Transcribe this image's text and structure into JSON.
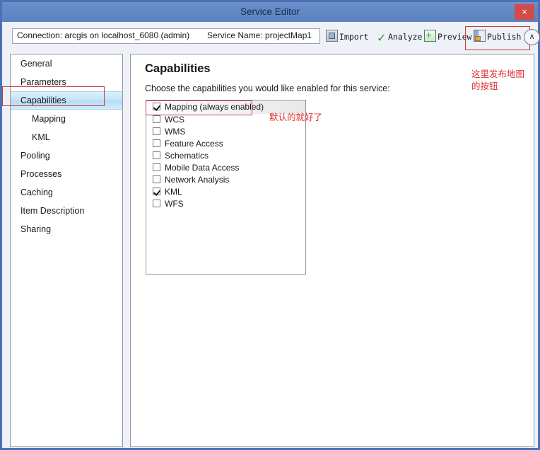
{
  "window": {
    "title": "Service Editor",
    "close_label": "×"
  },
  "toolbar": {
    "connection_text": "Connection: arcgis on localhost_6080 (admin)",
    "service_name_text": "Service Name: projectMap1",
    "buttons": [
      {
        "label": "Import",
        "icon": "import-icon"
      },
      {
        "label": "Analyze",
        "icon": "check-icon"
      },
      {
        "label": "Preview",
        "icon": "preview-icon"
      },
      {
        "label": "Publish",
        "icon": "publish-icon"
      }
    ],
    "collapse_label": "∧"
  },
  "sidebar": {
    "items": [
      {
        "label": "General",
        "indent": false,
        "selected": false
      },
      {
        "label": "Parameters",
        "indent": false,
        "selected": false
      },
      {
        "label": "Capabilities",
        "indent": false,
        "selected": true
      },
      {
        "label": "Mapping",
        "indent": true,
        "selected": false
      },
      {
        "label": "KML",
        "indent": true,
        "selected": false
      },
      {
        "label": "Pooling",
        "indent": false,
        "selected": false
      },
      {
        "label": "Processes",
        "indent": false,
        "selected": false
      },
      {
        "label": "Caching",
        "indent": false,
        "selected": false
      },
      {
        "label": "Item Description",
        "indent": false,
        "selected": false
      },
      {
        "label": "Sharing",
        "indent": false,
        "selected": false
      }
    ]
  },
  "main": {
    "title": "Capabilities",
    "subtitle": "Choose the capabilities you would like enabled for this service:",
    "capabilities": [
      {
        "label": "Mapping (always enabled)",
        "checked": true
      },
      {
        "label": "WCS",
        "checked": false
      },
      {
        "label": "WMS",
        "checked": false
      },
      {
        "label": "Feature Access",
        "checked": false
      },
      {
        "label": "Schematics",
        "checked": false
      },
      {
        "label": "Mobile Data Access",
        "checked": false
      },
      {
        "label": "Network Analysis",
        "checked": false
      },
      {
        "label": "KML",
        "checked": true
      },
      {
        "label": "WFS",
        "checked": false
      }
    ]
  },
  "annotations": {
    "publish_note": "这里发布地图\n的按钮",
    "default_note": "默认的就好了"
  },
  "colors": {
    "titlebar": "#6288c4",
    "close": "#d24b4b",
    "selection": "#c4e4f7",
    "annotation": "#e03030",
    "highlight_box": "#c23b3b"
  }
}
